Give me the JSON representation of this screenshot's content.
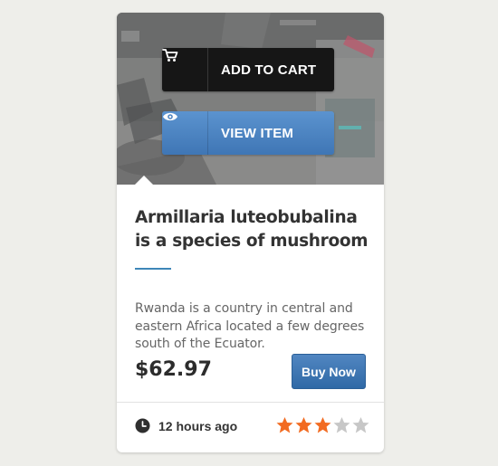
{
  "product": {
    "actions": {
      "add_to_cart_label": "ADD TO CART",
      "view_item_label": "VIEW ITEM"
    },
    "title": "Armillaria luteobubalina is a species of mushroom",
    "description": "Rwanda is a country in central and eastern Africa located a few degrees south of the Ecuator.",
    "price": "$62.97",
    "buy_label": "Buy Now",
    "posted": "12 hours ago",
    "rating": 3,
    "rating_max": 5,
    "icons": {
      "cart": "cart-icon",
      "view": "eye-icon",
      "time": "clock-icon",
      "rating": "star-icon"
    },
    "colors": {
      "accent": "#3e86b8",
      "button_blue": "#3f76b5",
      "dark_button": "#161616",
      "star_filled": "#f26b21",
      "star_empty": "#c7c7c7"
    }
  }
}
